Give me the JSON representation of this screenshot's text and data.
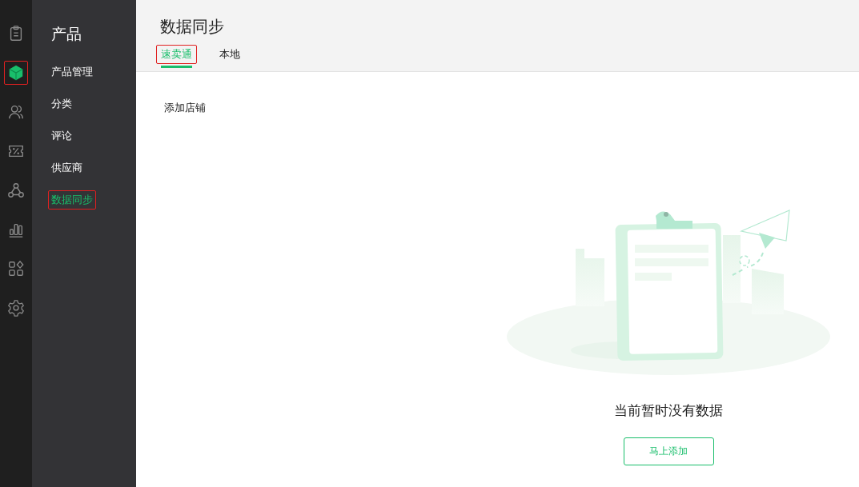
{
  "icon_rail": [
    {
      "selected": false
    },
    {
      "selected": true
    },
    {
      "selected": false
    },
    {
      "selected": false
    },
    {
      "selected": false
    },
    {
      "selected": false
    },
    {
      "selected": false
    },
    {
      "selected": false
    }
  ],
  "sidebar": {
    "title": "产品",
    "items": [
      {
        "label": "产品管理",
        "selected": false
      },
      {
        "label": "分类",
        "selected": false
      },
      {
        "label": "评论",
        "selected": false
      },
      {
        "label": "供应商",
        "selected": false
      },
      {
        "label": "数据同步",
        "selected": true
      }
    ]
  },
  "header": {
    "title": "数据同步",
    "tabs": [
      {
        "label": "速卖通",
        "selected": true
      },
      {
        "label": "本地",
        "selected": false
      }
    ]
  },
  "add_store_link": "添加店铺",
  "empty_state": {
    "message": "当前暂时没有数据",
    "button": "马上添加"
  }
}
